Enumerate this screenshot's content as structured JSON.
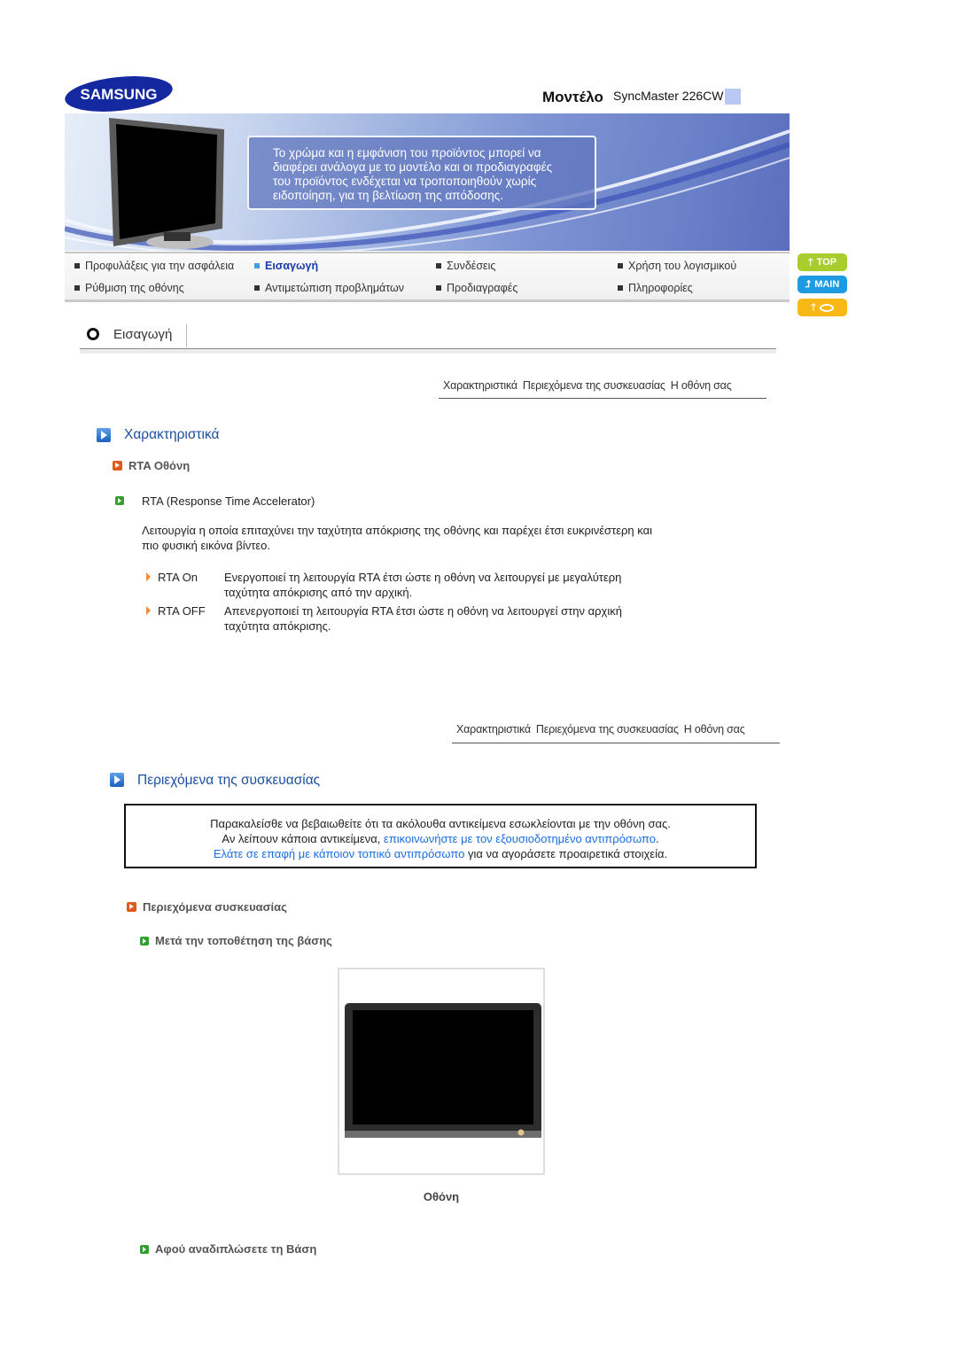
{
  "header": {
    "brand": "SAMSUNG",
    "model_label": "Μοντέλο",
    "model_value": "SyncMaster 226CW"
  },
  "banner": {
    "notice_lines": [
      "Το χρώμα και η εμφάνιση του προϊόντος μπορεί να",
      "διαφέρει ανάλογα με το μοντέλο και οι προδιαγραφές",
      "του προϊόντος ενδέχεται να τροποποιηθούν χωρίς",
      "ειδοποίηση, για τη βελτίωση της απόδοσης."
    ]
  },
  "nav": {
    "items": [
      {
        "label": "Προφυλάξεις για την ασφάλεια",
        "active": false
      },
      {
        "label": "Εισαγωγή",
        "active": true
      },
      {
        "label": "Συνδέσεις",
        "active": false
      },
      {
        "label": "Χρήση του λογισμικού",
        "active": false
      },
      {
        "label": "Ρύθμιση της οθόνης",
        "active": false
      },
      {
        "label": "Αντιμετώπιση προβλημάτων",
        "active": false
      },
      {
        "label": "Προδιαγραφές",
        "active": false
      },
      {
        "label": "Πληροφορίες",
        "active": false
      }
    ]
  },
  "side_buttons": {
    "top": "TOP",
    "main": "MAIN",
    "other_icon": "lips-icon"
  },
  "section": {
    "title": "Εισαγωγή"
  },
  "subnav": {
    "links": [
      "Χαρακτηριστικά",
      "Περιεχόμενα της συσκευασίας",
      "Η οθόνη σας"
    ]
  },
  "features": {
    "heading": "Χαρακτηριστικά",
    "subheading": "RTA Οθόνη",
    "item_title": "RTA (Response Time Accelerator)",
    "description_lines": [
      "Λειτουργία η οποία επιταχύνει την ταχύτητα απόκρισης της οθόνης και παρέχει έτσι ευκρινέστερη και",
      "πιο φυσική εικόνα βίντεο."
    ],
    "options": [
      {
        "name": "RTA On",
        "lines": [
          "Ενεργοποιεί τη λειτουργία RTA έτσι ώστε η οθόνη να λειτουργεί με μεγαλύτερη",
          "ταχύτητα απόκρισης από την αρχική."
        ]
      },
      {
        "name": "RTA OFF",
        "lines": [
          "Απενεργοποιεί τη λειτουργία RTA έτσι ώστε η οθόνη να λειτουργεί στην αρχική",
          "ταχύτητα απόκρισης."
        ]
      }
    ]
  },
  "package": {
    "heading": "Περιεχόμενα της συσκευασίας",
    "notice": {
      "line1": "Παρακαλείσθε να βεβαιωθείτε ότι τα ακόλουθα αντικείμενα εσωκλείονται με την οθόνη σας.",
      "line2_prefix": "Αν λείπουν κάποια αντικείμενα, ",
      "line2_link": "επικοινωνήστε με τον εξουσιοδοτημένο αντιπρόσωπο",
      "line2_suffix": ".",
      "line3_link": "Ελάτε σε επαφή με κάποιον τοπικό αντιπρόσωπο",
      "line3_suffix": " για να αγοράσετε προαιρετικά στοιχεία.",
      "link_color": "#1a6ee0"
    },
    "subheading": "Περιεχόμενα συσκευασίας",
    "after_stand": "Μετά την τοποθέτηση της βάσης",
    "photo_caption": "Οθόνη",
    "after_fold": "Αφού αναδιπλώσετε τη Βάση"
  }
}
